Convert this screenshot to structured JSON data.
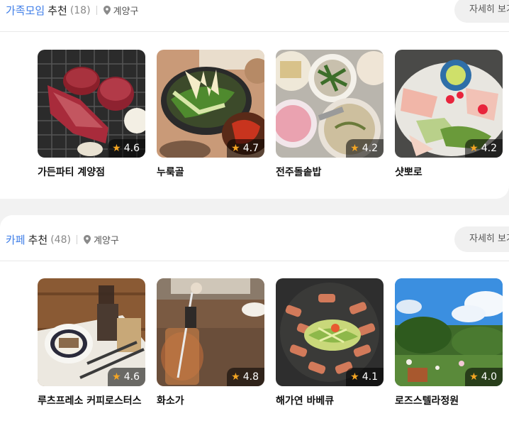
{
  "colors": {
    "accent": "#3f7ee8",
    "star": "#f5a623"
  },
  "sections": [
    {
      "accent": "가족모임",
      "title": "추천",
      "count": "(18)",
      "location": "계양구",
      "more_label": "자세히 보기",
      "items": [
        {
          "name": "가든파티 계양점",
          "rating": "4.6"
        },
        {
          "name": "누룩골",
          "rating": "4.7"
        },
        {
          "name": "전주돌솥밥",
          "rating": "4.2"
        },
        {
          "name": "샷뽀로",
          "rating": "4.2"
        }
      ]
    },
    {
      "accent": "카페",
      "title": "추천",
      "count": "(48)",
      "location": "계양구",
      "more_label": "자세히 보기",
      "items": [
        {
          "name": "루츠프레소 커피로스터스",
          "rating": "4.6"
        },
        {
          "name": "화소가",
          "rating": "4.8"
        },
        {
          "name": "해가연 바베큐",
          "rating": "4.1"
        },
        {
          "name": "로즈스텔라정원",
          "rating": "4.0"
        }
      ]
    }
  ]
}
